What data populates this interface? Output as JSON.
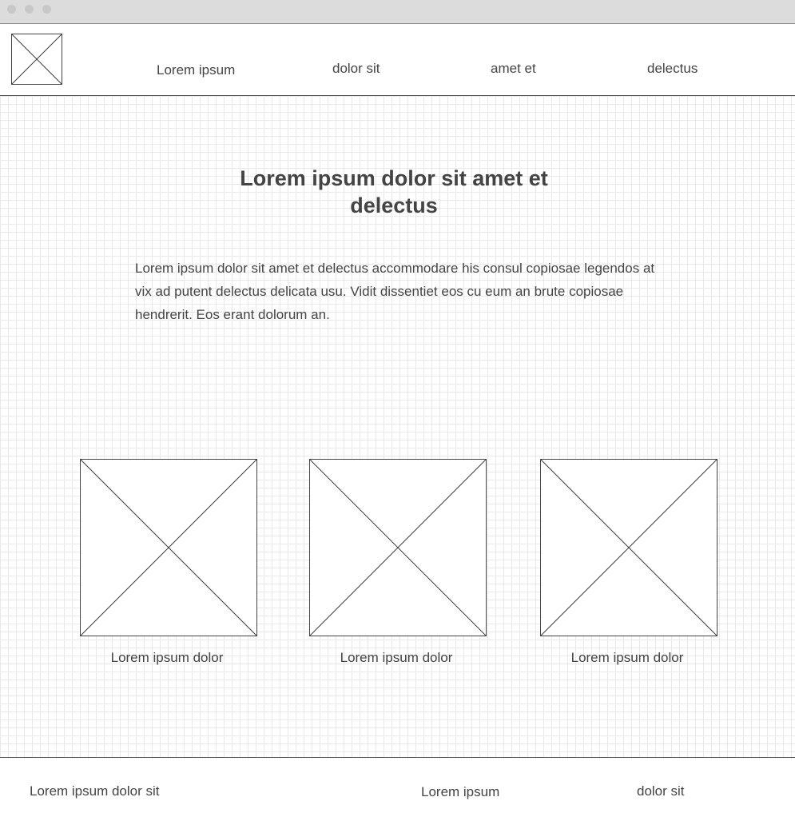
{
  "window": {
    "controls": [
      "close-dot",
      "minimize-dot",
      "maximize-dot"
    ]
  },
  "header": {
    "logo_icon": "image-placeholder-icon",
    "nav": [
      {
        "label": "Lorem ipsum"
      },
      {
        "label": "dolor sit"
      },
      {
        "label": "amet et"
      },
      {
        "label": "delectus"
      }
    ]
  },
  "main": {
    "title": "Lorem ipsum dolor sit amet et delectus",
    "body": "Lorem ipsum dolor sit amet et delectus accommodare his consul copiosae legendos at vix ad putent delectus delicata usu. Vidit dissentiet eos cu eum an brute copiosae hendrerit. Eos erant dolorum an.",
    "cards": [
      {
        "image_icon": "image-placeholder-icon",
        "caption": "Lorem ipsum dolor"
      },
      {
        "image_icon": "image-placeholder-icon",
        "caption": "Lorem ipsum dolor"
      },
      {
        "image_icon": "image-placeholder-icon",
        "caption": "Lorem ipsum dolor"
      }
    ]
  },
  "footer": {
    "links": [
      {
        "label": "Lorem ipsum dolor sit"
      },
      {
        "label": "Lorem ipsum"
      },
      {
        "label": "dolor sit"
      }
    ]
  },
  "colors": {
    "text": "#444444",
    "titlebar": "#dcdcdc",
    "grid": "#e9e9e9",
    "border": "#555555"
  }
}
